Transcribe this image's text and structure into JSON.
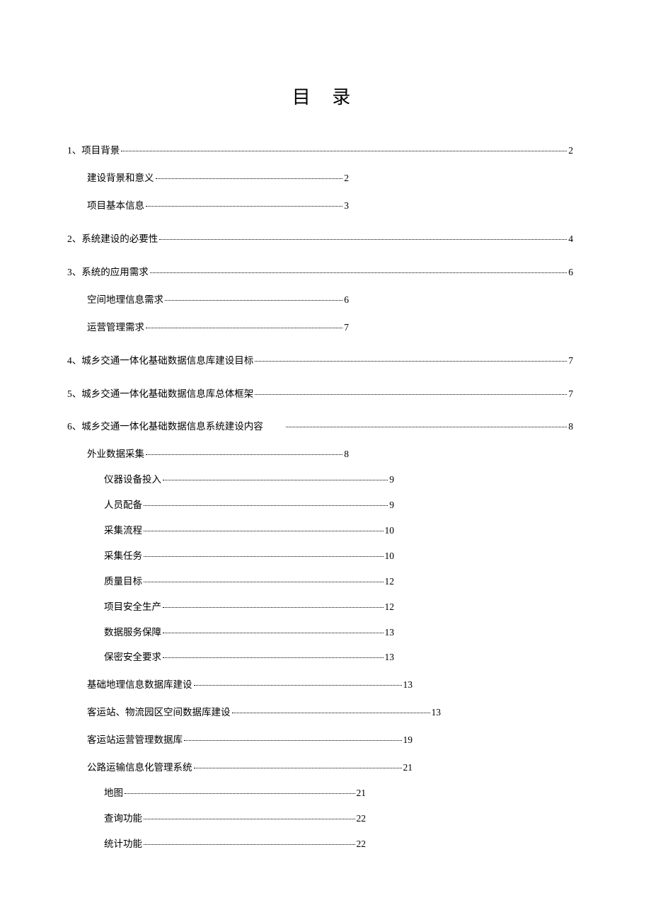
{
  "title": "目 录",
  "toc": {
    "s1": {
      "label": "1、项目背景",
      "page": "2"
    },
    "s1a": {
      "label": "建设背景和意义",
      "page": "2"
    },
    "s1b": {
      "label": "项目基本信息",
      "page": "3"
    },
    "s2": {
      "label": "2、系统建设的必要性",
      "page": "4"
    },
    "s3": {
      "label": "3、系统的应用需求",
      "page": "6"
    },
    "s3a": {
      "label": "空间地理信息需求",
      "page": "6"
    },
    "s3b": {
      "label": "运营管理需求",
      "page": "7"
    },
    "s4": {
      "label": "4、城乡交通一体化基础数据信息库建设目标",
      "page": "7"
    },
    "s5": {
      "label": "5、城乡交通一体化基础数据信息库总体框架",
      "page": "7"
    },
    "s6": {
      "label": "6、城乡交通一体化基础数据信息系统建设内容",
      "page": "8"
    },
    "s6a": {
      "label": "外业数据采集",
      "page": "8"
    },
    "s6a1": {
      "label": "仪器设备投入",
      "page": "9"
    },
    "s6a2": {
      "label": "人员配备",
      "page": "9"
    },
    "s6a3": {
      "label": "采集流程",
      "page": "10"
    },
    "s6a4": {
      "label": "采集任务",
      "page": "10"
    },
    "s6a5": {
      "label": "质量目标",
      "page": "12"
    },
    "s6a6": {
      "label": "项目安全生产",
      "page": "12"
    },
    "s6a7": {
      "label": "数据服务保障",
      "page": "13"
    },
    "s6a8": {
      "label": "保密安全要求",
      "page": "13"
    },
    "s6b": {
      "label": "基础地理信息数据库建设",
      "page": "13"
    },
    "s6c": {
      "label": "客运站、物流园区空间数据库建设",
      "page": "13"
    },
    "s6d": {
      "label": "客运站运营管理数据库",
      "page": "19"
    },
    "s6e": {
      "label": "公路运输信息化管理系统",
      "page": "21"
    },
    "s6e1": {
      "label": "地图",
      "page": "21"
    },
    "s6e2": {
      "label": "查询功能",
      "page": "22"
    },
    "s6e3": {
      "label": "统计功能",
      "page": "22"
    }
  }
}
